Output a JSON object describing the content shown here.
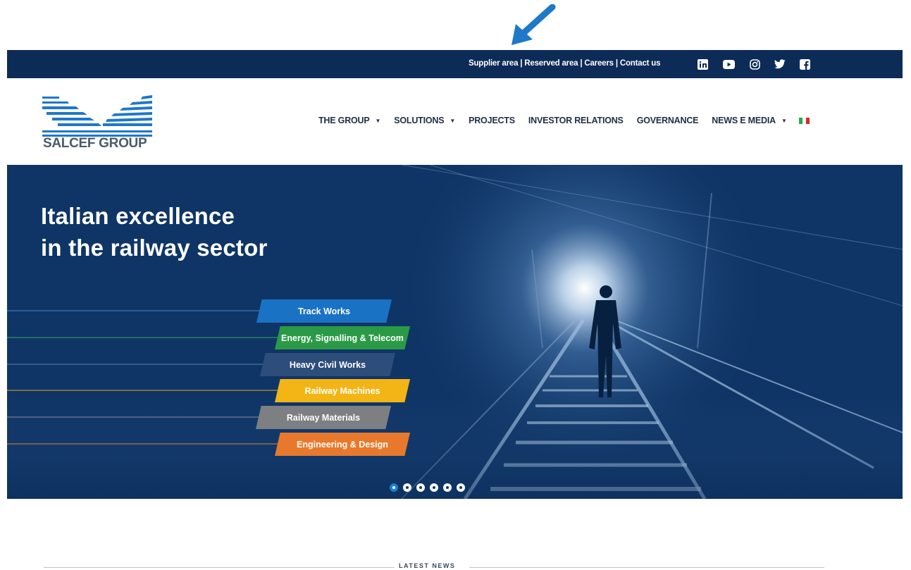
{
  "topbar": {
    "links": [
      "Supplier area",
      "Reserved area",
      "Careers",
      "Contact us"
    ],
    "separator": "|",
    "social_icons": [
      "linkedin-icon",
      "youtube-icon",
      "instagram-icon",
      "twitter-icon",
      "facebook-icon"
    ]
  },
  "header": {
    "logo_text": "SALCEF GROUP",
    "nav": [
      {
        "label": "THE GROUP",
        "dropdown": true
      },
      {
        "label": "SOLUTIONS",
        "dropdown": true
      },
      {
        "label": "PROJECTS",
        "dropdown": false
      },
      {
        "label": "INVESTOR RELATIONS",
        "dropdown": false
      },
      {
        "label": "GOVERNANCE",
        "dropdown": false
      },
      {
        "label": "NEWS E MEDIA",
        "dropdown": true
      }
    ],
    "caret": "▼",
    "language_flag": "italian-flag-icon"
  },
  "hero": {
    "title_line1": "Italian excellence",
    "title_line2": "in the railway sector",
    "tags": [
      {
        "label": "Track Works",
        "color": "#1a72c4"
      },
      {
        "label": "Energy, Signalling & Telecom",
        "color": "#2a9a47"
      },
      {
        "label": "Heavy Civil Works",
        "color": "#2d4d7a"
      },
      {
        "label": "Railway Machines",
        "color": "#f2b515"
      },
      {
        "label": "Railway Materials",
        "color": "#7d7f83"
      },
      {
        "label": "Engineering & Design",
        "color": "#e8792c"
      }
    ],
    "slides_count": 6,
    "active_slide": 1
  },
  "news": {
    "label": "LATEST NEWS"
  },
  "colors": {
    "navy": "#0d2b57",
    "hero_bg": "#0f3566",
    "annotation_arrow": "#1f78c8"
  }
}
